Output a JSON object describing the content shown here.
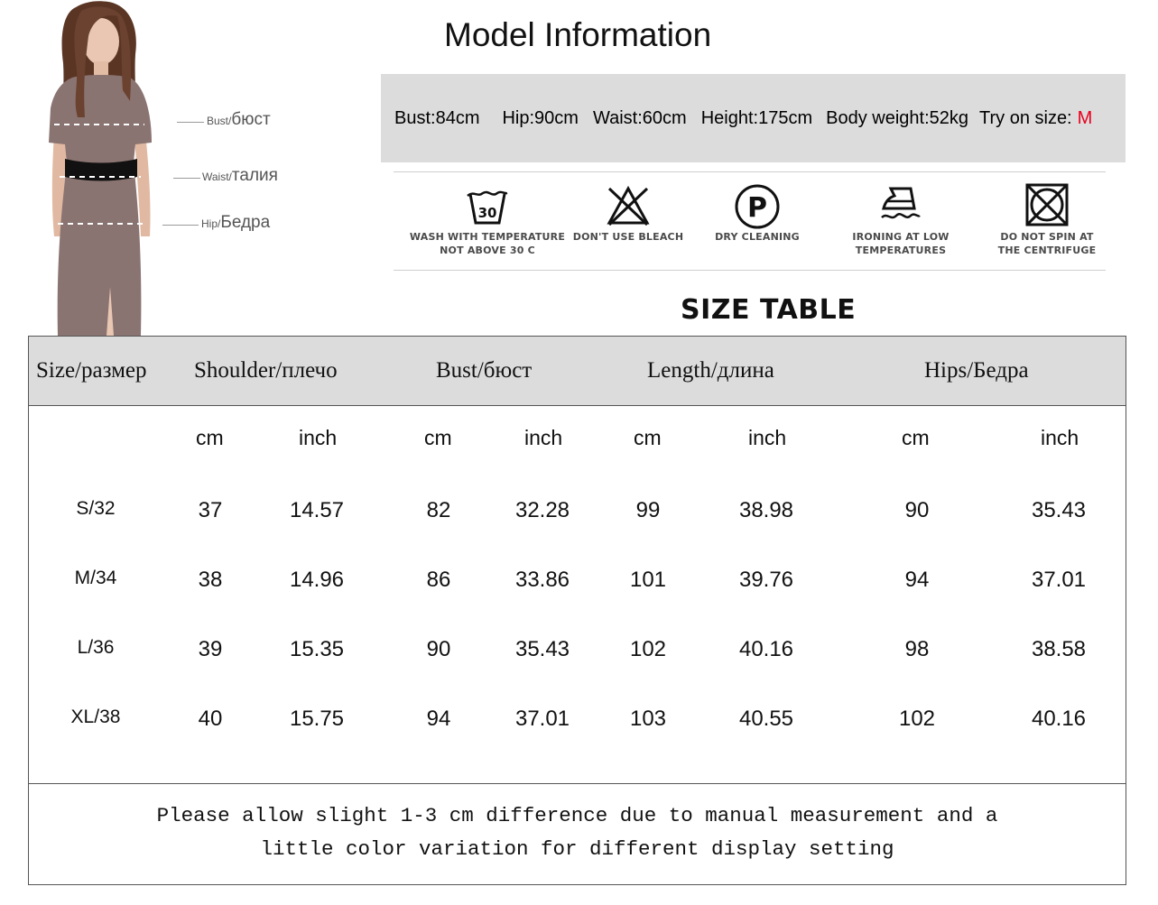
{
  "model_labels": {
    "bust": {
      "en": "Bust/",
      "ru": "бюст"
    },
    "waist": {
      "en": "Waist/",
      "ru": "талия"
    },
    "hip": {
      "en": "Hip/",
      "ru": "Бедра"
    }
  },
  "model_info": {
    "title": "Model Information",
    "bust": "Bust:84cm",
    "hip": "Hip:90cm",
    "waist": "Waist:60cm",
    "height": "Height:175cm",
    "weight": "Body weight:52kg",
    "try_label": "Try on size:",
    "try_value": "M"
  },
  "care": {
    "wash": {
      "line1": "WASH WITH TEMPERATURE",
      "line2": "NOT ABOVE 30 C",
      "icon_text": "30"
    },
    "bleach": {
      "line1": "DON'T USE BLEACH"
    },
    "dry": {
      "line1": "DRY CLEANING",
      "icon_text": "P"
    },
    "iron": {
      "line1": "IRONING AT LOW",
      "line2": "TEMPERATURES"
    },
    "spin": {
      "line1": "DO NOT SPIN AT",
      "line2": "THE CENTRIFUGE"
    }
  },
  "size_table": {
    "title": "SIZE TABLE",
    "headers": {
      "size": "Size/размер",
      "shoulder": "Shoulder/плечо",
      "bust": "Bust/бюст",
      "length": "Length/длина",
      "hips": "Hips/Бедра"
    },
    "units": {
      "cm": "cm",
      "inch": "inch"
    },
    "rows": [
      {
        "size": "S/32",
        "shoulder_cm": "37",
        "shoulder_in": "14.57",
        "bust_cm": "82",
        "bust_in": "32.28",
        "length_cm": "99",
        "length_in": "38.98",
        "hips_cm": "90",
        "hips_in": "35.43"
      },
      {
        "size": "M/34",
        "shoulder_cm": "38",
        "shoulder_in": "14.96",
        "bust_cm": "86",
        "bust_in": "33.86",
        "length_cm": "101",
        "length_in": "39.76",
        "hips_cm": "94",
        "hips_in": "37.01"
      },
      {
        "size": "L/36",
        "shoulder_cm": "39",
        "shoulder_in": "15.35",
        "bust_cm": "90",
        "bust_in": "35.43",
        "length_cm": "102",
        "length_in": "40.16",
        "hips_cm": "98",
        "hips_in": "38.58"
      },
      {
        "size": "XL/38",
        "shoulder_cm": "40",
        "shoulder_in": "15.75",
        "bust_cm": "94",
        "bust_in": "37.01",
        "length_cm": "103",
        "length_in": "40.55",
        "hips_cm": "102",
        "hips_in": "40.16"
      }
    ],
    "note_line1": "Please allow slight 1-3 cm difference due to manual measurement and a",
    "note_line2": "little color variation for different display setting"
  },
  "colors": {
    "accent_red": "#e8001c",
    "panel_gray": "#dcdcdc",
    "dress": "#8a7471"
  }
}
